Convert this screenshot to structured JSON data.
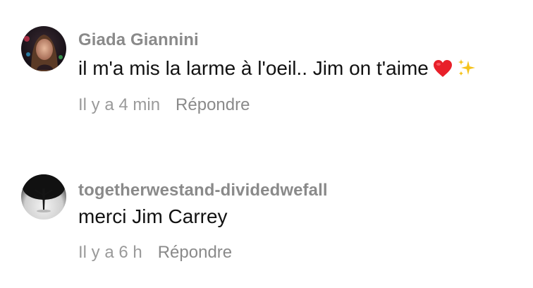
{
  "comments": [
    {
      "username": "Giada Giannini",
      "text": "il m'a mis la larme à l'oeil.. Jim on t'aime",
      "emojis": [
        "red-heart",
        "sparkles"
      ],
      "time": "Il y a 4 min",
      "reply_label": "Répondre",
      "avatar": "profile-photo"
    },
    {
      "username": "togetherwestand-dividedwefall",
      "text": "merci Jim Carrey",
      "time": "Il y a 6 h",
      "reply_label": "Répondre",
      "avatar": "tree-silhouette-photo"
    }
  ],
  "colors": {
    "username": "#8a8a8a",
    "text": "#121212",
    "meta": "#9a9a9a",
    "heart": "#e8202a",
    "sparkle": "#f5c21b"
  }
}
